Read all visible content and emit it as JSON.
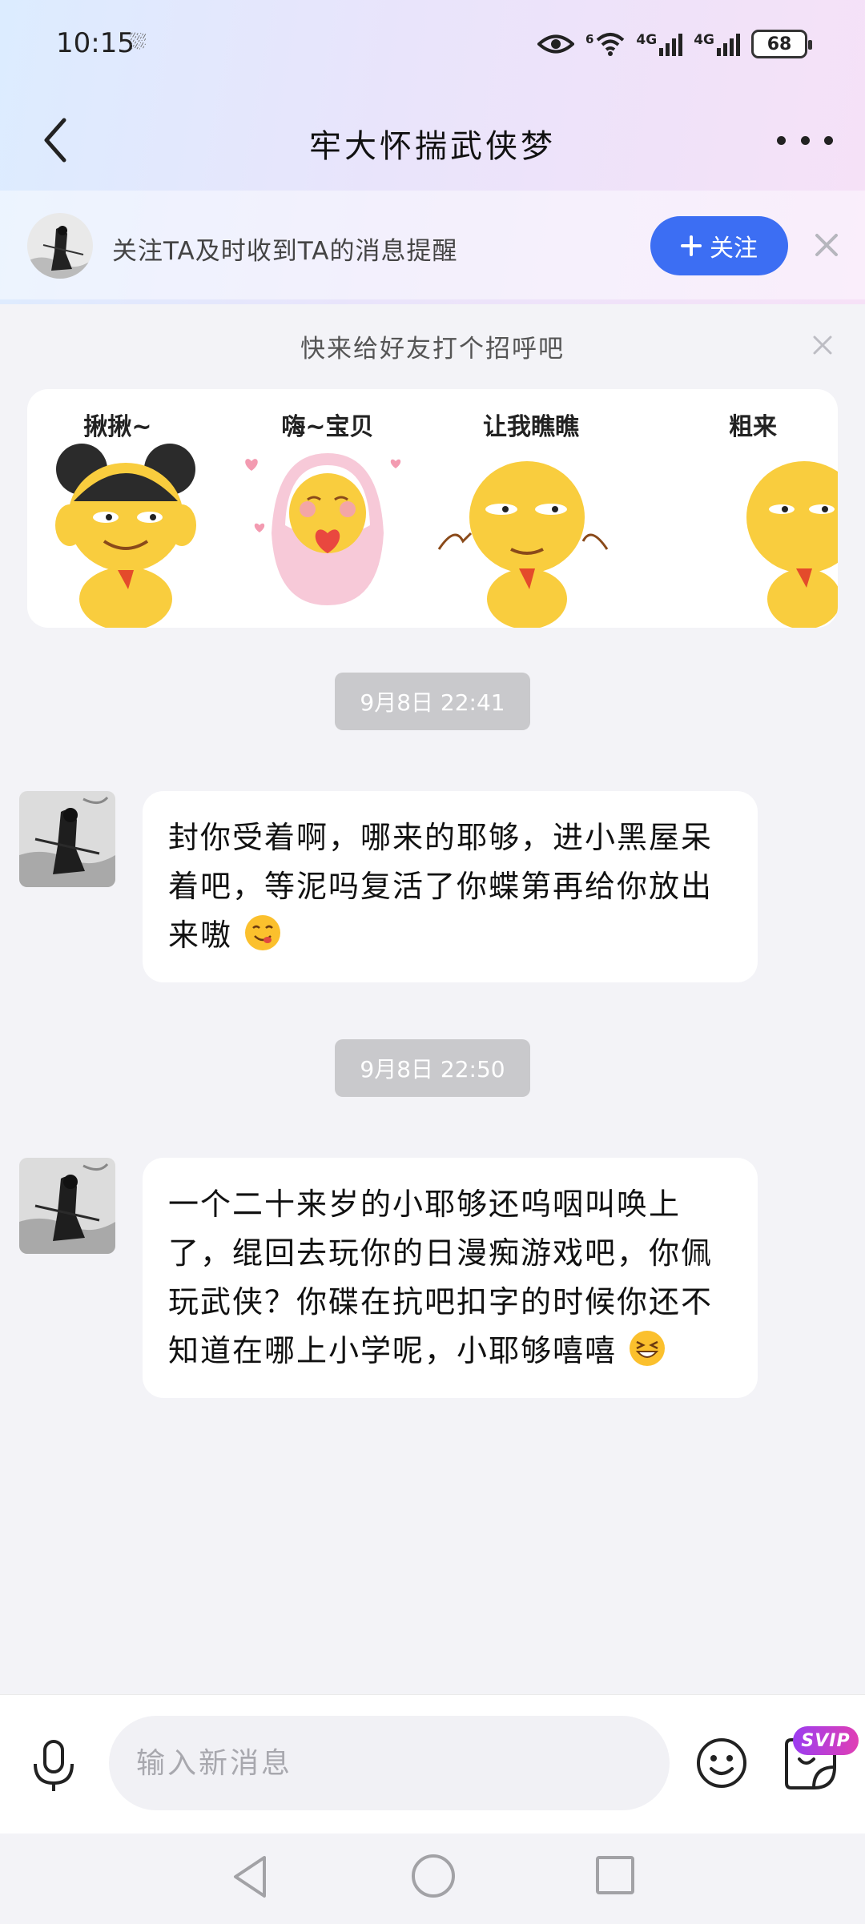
{
  "status_bar": {
    "time": "10:15",
    "extra": "⛆",
    "network_1": "4G",
    "network_2": "4G",
    "wifi_badge": "6",
    "battery": "68"
  },
  "header": {
    "title": "牢大怀揣武侠梦"
  },
  "follow_banner": {
    "text": "关注TA及时收到TA的消息提醒",
    "button_label": "关注"
  },
  "greeting": {
    "title": "快来给好友打个招呼吧",
    "stickers": [
      {
        "label": "揪揪~"
      },
      {
        "label": "嗨~宝贝"
      },
      {
        "label": "让我瞧瞧"
      },
      {
        "label": "粗来"
      }
    ]
  },
  "messages": [
    {
      "timestamp": "9月8日  22:41",
      "text": "封你受着啊，哪来的耶够，进小黑屋呆着吧，等泥吗复活了你蝶第再给你放出来嗷",
      "emoji": "yum-face-emoji"
    },
    {
      "timestamp": "9月8日  22:50",
      "text": "一个二十来岁的小耶够还呜咽叫唤上了，绲回去玩你的日漫痴游戏吧，你佩玩武侠？你碟在抗吧扣字的时候你还不知道在哪上小学呢，小耶够嘻嘻",
      "emoji": "grinning-squint-emoji"
    }
  ],
  "input_bar": {
    "placeholder": "输入新消息",
    "svip_label": "SVIP"
  },
  "colors": {
    "accent": "#3c6ef3",
    "bubble": "#ffffff",
    "timestamp_bg": "#c9c9cc"
  }
}
